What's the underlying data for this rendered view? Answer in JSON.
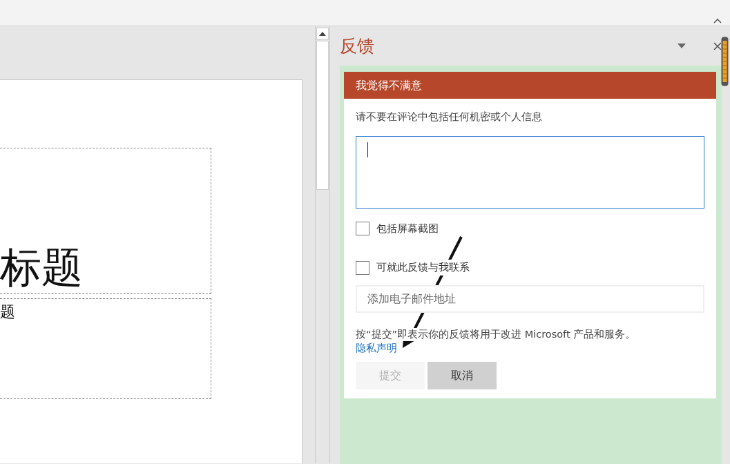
{
  "slide": {
    "title_text": "标题",
    "subtitle_text": "题"
  },
  "pane": {
    "title": "反馈",
    "card_header": "我觉得不满意",
    "notice": "请不要在评论中包括任何机密或个人信息",
    "checkboxes": [
      {
        "label": "包括屏幕截图",
        "checked": false
      },
      {
        "label": "可就此反馈与我联系",
        "checked": false
      }
    ],
    "email": {
      "placeholder": "添加电子邮件地址"
    },
    "disclaimer": "按“提交”即表示你的反馈将用于改进 Microsoft 产品和服务。",
    "privacy_link": "隐私声明",
    "buttons": [
      {
        "label": "提交",
        "disabled": true
      },
      {
        "label": "取消",
        "disabled": false
      }
    ]
  }
}
